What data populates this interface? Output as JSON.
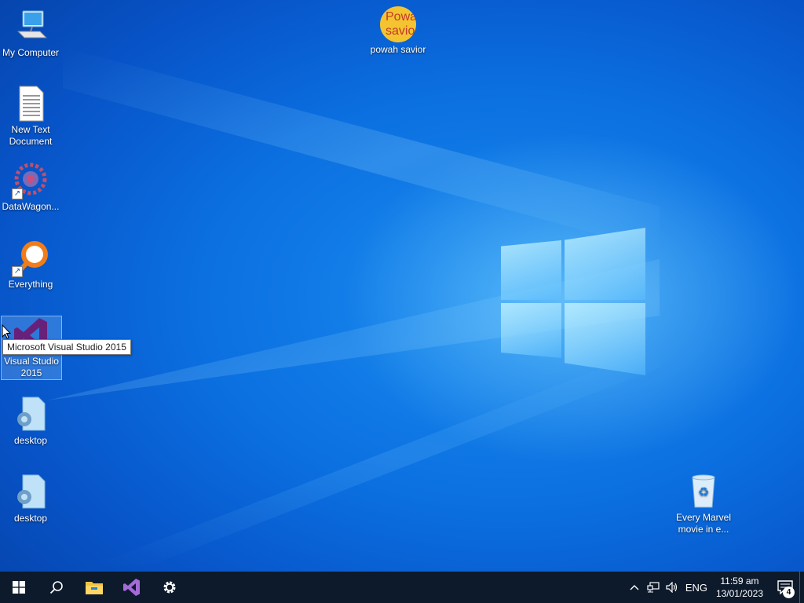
{
  "desktop": {
    "icons": [
      {
        "id": "my-computer",
        "label": "My Computer"
      },
      {
        "id": "new-text-document",
        "label": "New Text\nDocument"
      },
      {
        "id": "datawagon",
        "label": "DataWagon..."
      },
      {
        "id": "everything",
        "label": "Everything"
      },
      {
        "id": "visual-studio",
        "label": "Visual Studio\n2015"
      },
      {
        "id": "desktop-1",
        "label": "desktop"
      },
      {
        "id": "desktop-2",
        "label": "desktop"
      },
      {
        "id": "powah-savior",
        "label": "powah savior",
        "logo_text": "Powah savior"
      },
      {
        "id": "recycle-bin",
        "label": "Every Marvel\nmovie in e..."
      }
    ],
    "tooltip": "Microsoft Visual Studio 2015"
  },
  "taskbar": {
    "pinned": [
      "start-button",
      "search-button",
      "file-explorer",
      "visual-studio",
      "settings"
    ],
    "tray": {
      "language": "ENG",
      "time": "11:59 am",
      "date": "13/01/2023",
      "notification_count": "4"
    }
  },
  "colors": {
    "wallpaper": "#0b6fe0",
    "taskbar": "#0d1a2b",
    "vs_purple": "#68217a",
    "powah_yellow": "#f4c430"
  }
}
